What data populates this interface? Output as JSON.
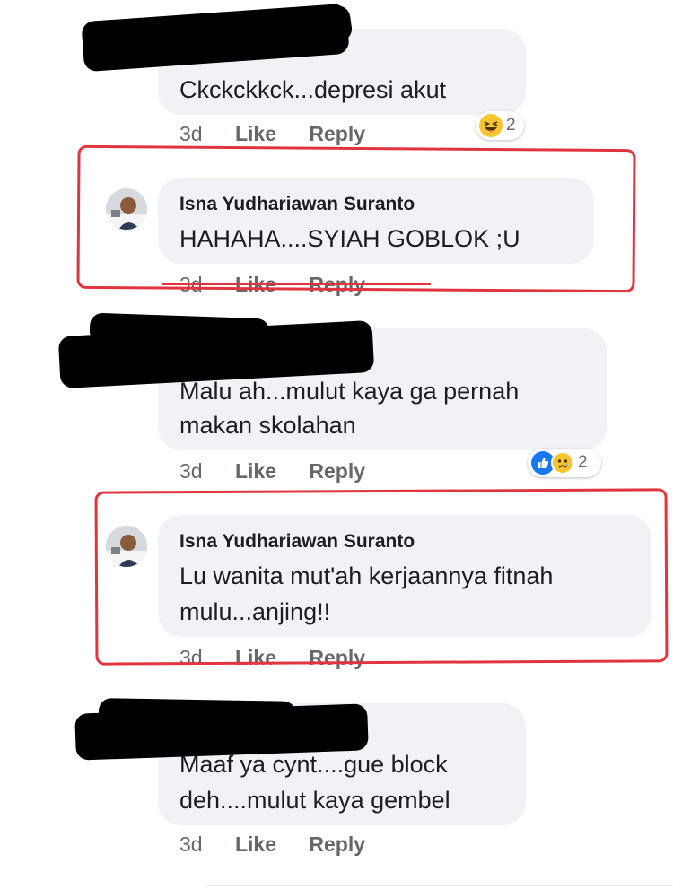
{
  "comments": [
    {
      "text_lines": [
        "Ckckckkck...depresi akut"
      ],
      "time": "3d",
      "like": "Like",
      "reply": "Reply",
      "reaction": {
        "type": "haha",
        "count": "2"
      }
    },
    {
      "author": "Isna Yudhariawan Suranto",
      "text_lines": [
        "HAHAHA....SYIAH GOBLOK ;U"
      ],
      "time": "3d",
      "like": "Like",
      "reply": "Reply"
    },
    {
      "text_lines": [
        "Malu ah...mulut kaya ga pernah",
        "makan skolahan"
      ],
      "time": "3d",
      "like": "Like",
      "reply": "Reply",
      "reaction": {
        "type": "like-sad",
        "count": "2"
      }
    },
    {
      "author": "Isna Yudhariawan Suranto",
      "text_lines": [
        "Lu wanita mut'ah kerjaannya fitnah",
        "mulu...anjing!!"
      ],
      "time": "3d",
      "like": "Like",
      "reply": "Reply"
    },
    {
      "text_lines": [
        "Maaf ya cynt....gue block",
        "deh....mulut kaya gembel"
      ],
      "time": "3d",
      "like": "Like",
      "reply": "Reply"
    }
  ],
  "colors": {
    "bubble": "#f0f2f5",
    "meta_text": "#65676b",
    "annotation": "#e0343f",
    "like_blue": "#1877f2"
  },
  "icons": {
    "haha_reaction": "laughing-emoji-icon",
    "like_reaction": "thumbs-up-icon",
    "sad_reaction": "crying-emoji-icon"
  }
}
